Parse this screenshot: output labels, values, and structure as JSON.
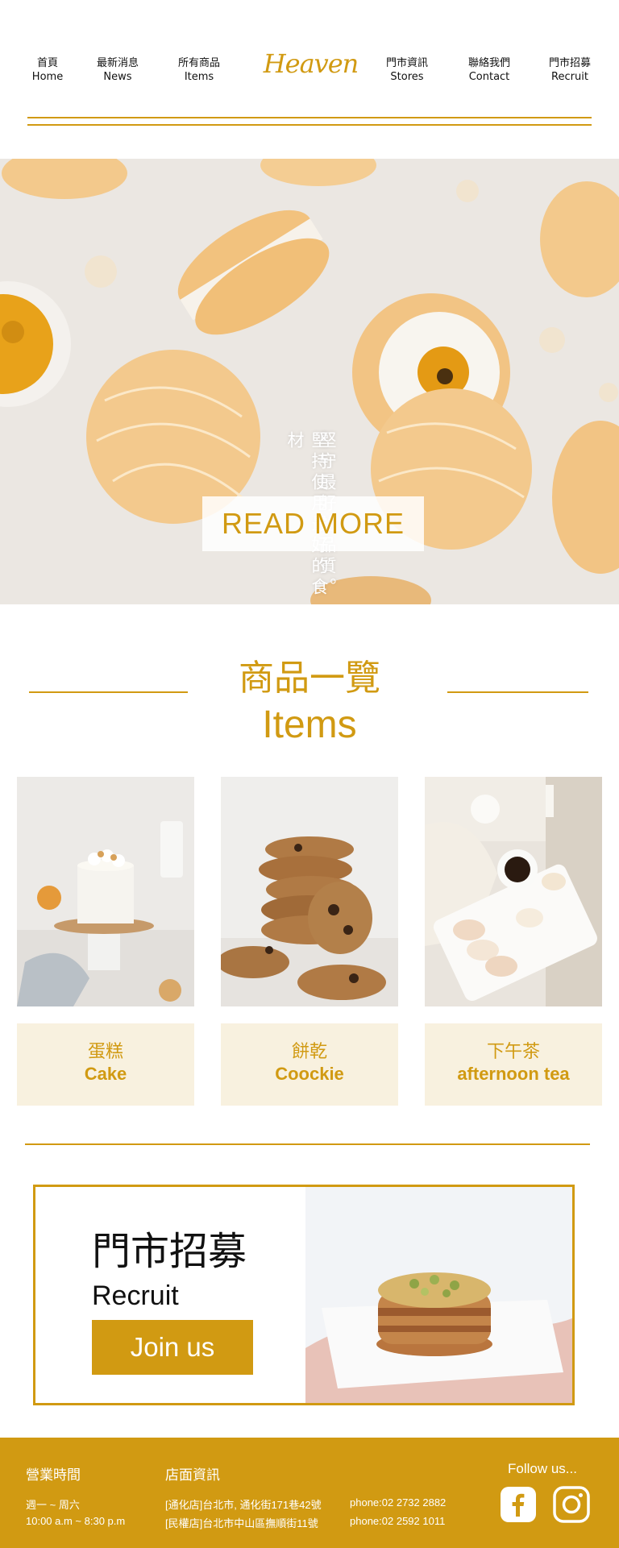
{
  "nav": {
    "logo": "Heaven",
    "items": [
      {
        "zh": "首頁",
        "en": "Home"
      },
      {
        "zh": "最新消息",
        "en": "News"
      },
      {
        "zh": "所有商品",
        "en": "Items"
      },
      {
        "zh": "門市資訊",
        "en": "Stores"
      },
      {
        "zh": "聯絡我們",
        "en": "Contact"
      },
      {
        "zh": "門市招募",
        "en": "Recruit"
      }
    ]
  },
  "hero": {
    "line1": "堅守最好的品質。",
    "line2": "堅持使用最好的食材",
    "button": "READ MORE"
  },
  "items_section": {
    "title_zh": "商品一覽",
    "title_en": "Items",
    "cards": [
      {
        "zh": "蛋糕",
        "en": "Cake"
      },
      {
        "zh": "餅乾",
        "en": "Coockie"
      },
      {
        "zh": "下午茶",
        "en": "afternoon tea"
      }
    ]
  },
  "recruit": {
    "title_zh": "門市招募",
    "title_en": "Recruit",
    "button": "Join us"
  },
  "footer": {
    "hours_title": "營業時間",
    "hours_days": "週一 ~ 周六",
    "hours_time": "10:00 a.m ~ 8:30 p.m",
    "stores_title": "店面資訊",
    "store1_address": "[通化店]台北市, 通化街171巷42號",
    "store1_phone": "phone:02 2732 2882",
    "store2_address": "[民權店]台北市中山區撫順街11號",
    "store2_phone": "phone:02 2592 1011",
    "follow": "Follow us...",
    "social_icons": [
      "facebook-icon",
      "instagram-icon"
    ]
  },
  "colors": {
    "accent": "#d19a12",
    "card_background": "#f8f1df"
  }
}
